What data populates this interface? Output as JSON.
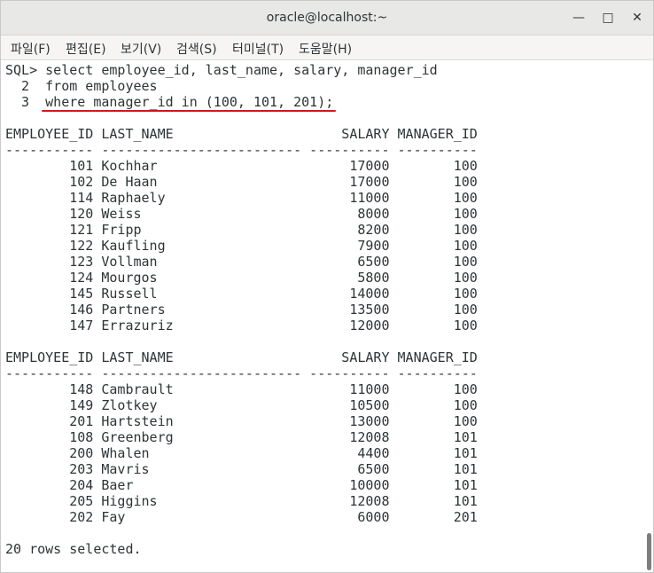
{
  "window": {
    "title": "oracle@localhost:~",
    "minimize_glyph": "—",
    "maximize_glyph": "□",
    "close_glyph": "✕"
  },
  "menu": [
    "파일(F)",
    "편집(E)",
    "보기(V)",
    "검색(S)",
    "터미널(T)",
    "도움말(H)"
  ],
  "terminal": {
    "query_lines": [
      "SQL> select employee_id, last_name, salary, manager_id",
      "  2  from employees",
      "  3  where manager_id in (100, 101, 201);"
    ],
    "header": "EMPLOYEE_ID LAST_NAME                     SALARY MANAGER_ID",
    "separator": "----------- ------------------------- ---------- ----------",
    "page1": [
      "        101 Kochhar                        17000        100",
      "        102 De Haan                        17000        100",
      "        114 Raphaely                       11000        100",
      "        120 Weiss                           8000        100",
      "        121 Fripp                           8200        100",
      "        122 Kaufling                        7900        100",
      "        123 Vollman                         6500        100",
      "        124 Mourgos                         5800        100",
      "        145 Russell                        14000        100",
      "        146 Partners                       13500        100",
      "        147 Errazuriz                      12000        100"
    ],
    "page2": [
      "        148 Cambrault                      11000        100",
      "        149 Zlotkey                        10500        100",
      "        201 Hartstein                      13000        100",
      "        108 Greenberg                      12008        101",
      "        200 Whalen                          4400        101",
      "        203 Mavris                          6500        101",
      "        204 Baer                           10000        101",
      "        205 Higgins                        12008        101",
      "        202 Fay                             6000        201"
    ],
    "footer": "20 rows selected."
  },
  "colors": {
    "underline": "#d8141b",
    "text": "#2e3436",
    "titlebar": "#e8e8e7"
  }
}
